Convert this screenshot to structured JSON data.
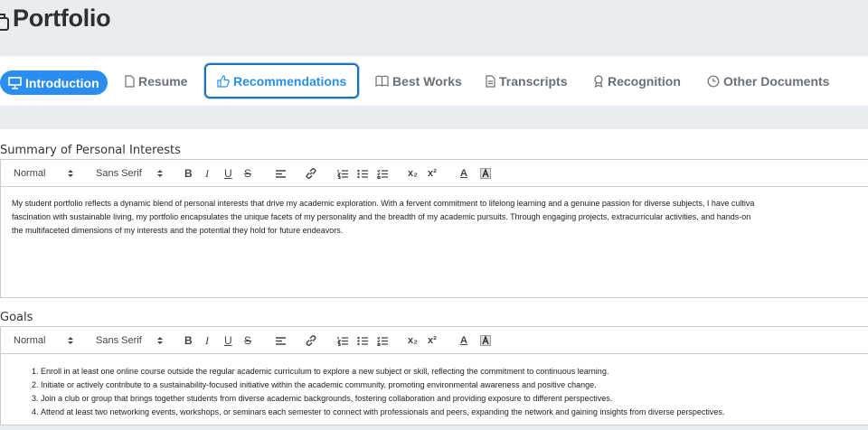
{
  "header": {
    "title": "Portfolio"
  },
  "tabs": [
    {
      "label": "Introduction",
      "icon": "presentation-icon"
    },
    {
      "label": "Resume",
      "icon": "document-icon"
    },
    {
      "label": "Recommendations",
      "icon": "thumbs-up-icon"
    },
    {
      "label": "Best Works",
      "icon": "open-book-icon"
    },
    {
      "label": "Transcripts",
      "icon": "document-lines-icon"
    },
    {
      "label": "Recognition",
      "icon": "award-icon"
    },
    {
      "label": "Other Documents",
      "icon": "clock-icon"
    }
  ],
  "colors": {
    "accent": "#2a8ef0",
    "focus_border": "#1b6fb8",
    "page_bg": "#e9ecf1"
  },
  "toolbar": {
    "format_value": "Normal",
    "font_value": "Sans Serif",
    "bold": "B",
    "italic": "I",
    "underline": "U",
    "strike": "S",
    "subscript": "x₂",
    "superscript": "x²",
    "font_color": "A"
  },
  "summary": {
    "label": "Summary of Personal Interests",
    "lines": [
      "My student portfolio reflects a dynamic blend of personal interests that drive my academic exploration. With a fervent commitment to lifelong learning and a genuine passion for diverse subjects, I have cultiva",
      "fascination with sustainable living, my portfolio encapsulates the unique facets of my personality and the breadth of my academic pursuits. Through engaging projects, extracurricular activities, and hands-on",
      "the multifaceted dimensions of my interests and the potential they hold for future endeavors."
    ]
  },
  "goals": {
    "label": "Goals",
    "items": [
      "Enroll in at least one online course outside the regular academic curriculum to explore a new subject or skill, reflecting the commitment to continuous learning.",
      "Initiate or actively contribute to a sustainability-focused initiative within the academic community, promoting environmental awareness and positive change.",
      "Join a club or group that brings together students from diverse academic backgrounds, fostering collaboration and providing exposure to different perspectives.",
      "Attend at least two networking events, workshops, or seminars each semester to connect with professionals and peers, expanding the network and gaining insights from diverse perspectives."
    ]
  }
}
